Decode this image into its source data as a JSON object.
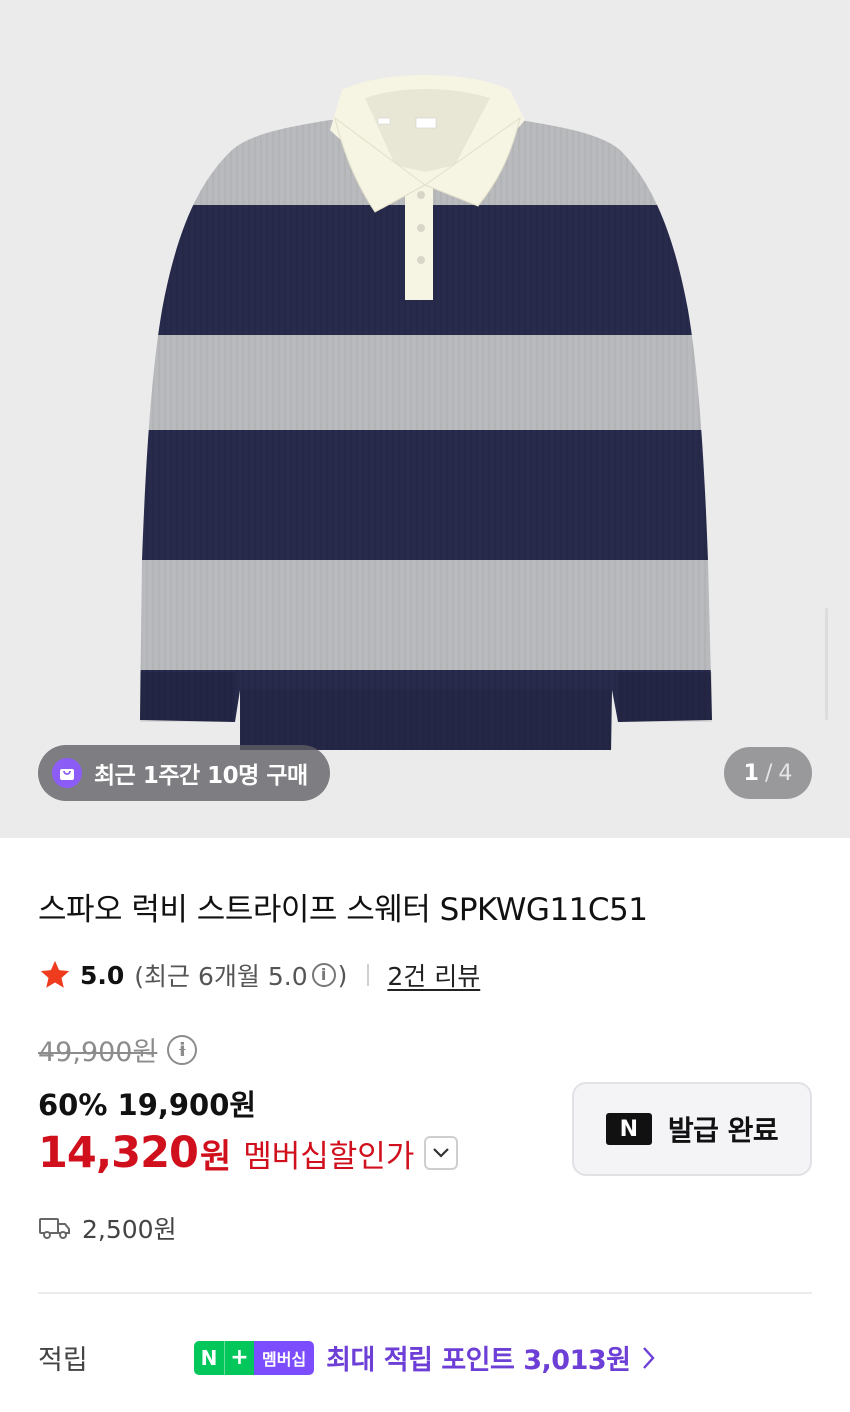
{
  "gallery": {
    "recent_purchase_badge": "최근 1주간 10명 구매",
    "current_index": "1",
    "separator": "/",
    "total": "4"
  },
  "product": {
    "title": "스파오 럭비 스트라이프 스웨터 SPKWG11C51",
    "rating_score": "5.0",
    "rating_recent_prefix": "(최근 6개월 5.0",
    "rating_recent_suffix": ")",
    "review_link": "2건 리뷰",
    "original_price": "49,900원",
    "sale_text": "60% 19,900원",
    "member_price": "14,320",
    "member_price_unit": "원",
    "member_tag": "멤버십할인가",
    "shipping_fee": "2,500원"
  },
  "coupon": {
    "logo_letter": "N",
    "label": "발급 완료"
  },
  "points": {
    "label": "적립",
    "badge_n": "N",
    "badge_plus": "+",
    "badge_member": "멤버십",
    "text": "최대 적립 포인트 3,013원"
  },
  "colors": {
    "discount_red": "#d0101d",
    "naver_green": "#03c75a",
    "member_purple": "#7c4dff",
    "points_text": "#6d3fd6",
    "star": "#f03c1e",
    "sweater_navy": "#272a4a",
    "sweater_gray": "#b9babd",
    "collar_cream": "#f6f4e2"
  },
  "icons": [
    "shopping-bag-icon",
    "star-icon",
    "info-icon",
    "chevron-down-icon",
    "delivery-truck-icon",
    "chevron-right-icon"
  ]
}
